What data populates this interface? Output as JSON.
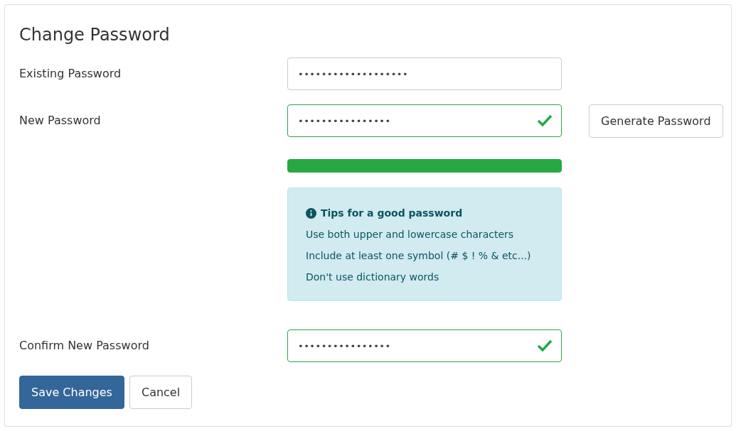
{
  "title": "Change Password",
  "fields": [
    {
      "label": "Existing Password",
      "value": "•••••••••••••••••••",
      "valid": false
    },
    {
      "label": "New Password",
      "value": "••••••••••••••••",
      "valid": true,
      "button": "Generate Password",
      "strength": {
        "level": 1
      },
      "tips": {
        "heading": "Tips for a good password",
        "items": [
          "Use both upper and lowercase characters",
          "Include at least one symbol (# $ ! % & etc...)",
          "Don't use dictionary words"
        ]
      }
    },
    {
      "label": "Confirm New Password",
      "value": "••••••••••••••••",
      "valid": true
    }
  ],
  "buttons": [
    {
      "label": "Save Changes",
      "kind": "primary"
    },
    {
      "label": "Cancel",
      "kind": "default"
    }
  ]
}
